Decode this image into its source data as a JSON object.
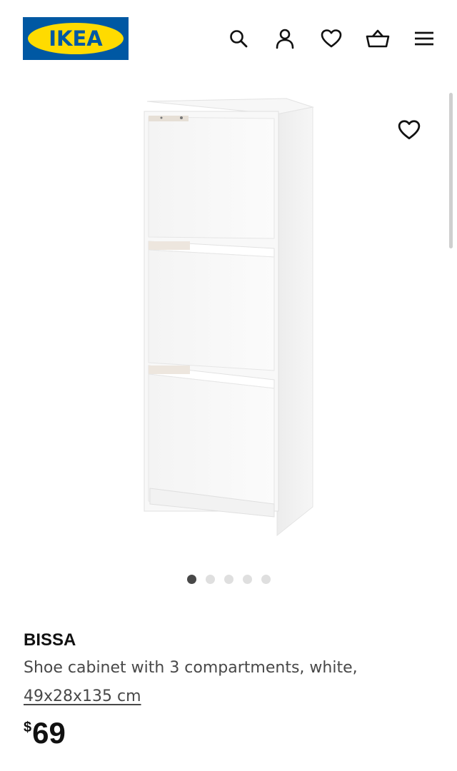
{
  "header": {
    "logo_text": "IKEA",
    "brand_colors": {
      "blue": "#0058a3",
      "yellow": "#ffdb00"
    },
    "icons": [
      "search-icon",
      "user-icon",
      "heart-icon",
      "basket-icon",
      "menu-icon"
    ]
  },
  "gallery": {
    "image_count": 5,
    "active_index": 0,
    "favorite_icon": "heart-icon"
  },
  "product": {
    "name": "BISSA",
    "description": "Shoe cabinet with 3 compartments, white,",
    "size": "49x28x135 cm",
    "price_currency": "$",
    "price_amount": "69"
  }
}
